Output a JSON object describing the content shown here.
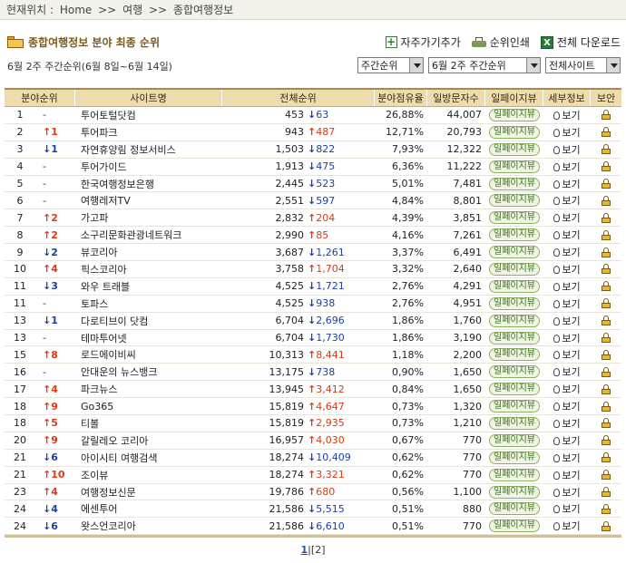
{
  "breadcrumb": {
    "label": "현재위치 :",
    "items": [
      "Home",
      ">>",
      "여행",
      ">>",
      "종합여행정보"
    ]
  },
  "page_title": "종합여행정보 분야 최종 순위",
  "toolbar": {
    "favorite": "자주가기추가",
    "print": "순위인쇄",
    "download": "전체 다운로드"
  },
  "sub_info": "6월 2주 주간순위(6월 8일~6월 14일)",
  "selects": {
    "period_type": "주간순위",
    "week": "6월 2주 주간순위",
    "scope": "전체사이트"
  },
  "columns": [
    "분야순위",
    "사이트명",
    "전체순위",
    "분야점유율",
    "일방문자수",
    "일페이지뷰",
    "세부정보",
    "보안"
  ],
  "view_label": "일페이지뷰",
  "detail_label": "보기",
  "colors": {
    "up": "#e03a12",
    "down": "#1b3fa8",
    "header": "#efdcae"
  },
  "rows": [
    {
      "rank": "1",
      "arrow": "",
      "chg": "-",
      "name": "투어토털닷컴",
      "total": "453",
      "tarrow": "↓",
      "tchg": "63",
      "share": "26,88%",
      "visitors": "44,007"
    },
    {
      "rank": "2",
      "arrow": "↑",
      "chg": "1",
      "name": "투어파크",
      "total": "943",
      "tarrow": "↑",
      "tchg": "487",
      "share": "12,71%",
      "visitors": "20,793"
    },
    {
      "rank": "3",
      "arrow": "↓",
      "chg": "1",
      "name": "자연휴양림 정보서비스",
      "total": "1,503",
      "tarrow": "↓",
      "tchg": "822",
      "share": "7,93%",
      "visitors": "12,322"
    },
    {
      "rank": "4",
      "arrow": "",
      "chg": "-",
      "name": "투어가이드",
      "total": "1,913",
      "tarrow": "↓",
      "tchg": "475",
      "share": "6,36%",
      "visitors": "11,222"
    },
    {
      "rank": "5",
      "arrow": "",
      "chg": "-",
      "name": "한국여행정보은행",
      "total": "2,445",
      "tarrow": "↓",
      "tchg": "523",
      "share": "5,01%",
      "visitors": "7,481"
    },
    {
      "rank": "6",
      "arrow": "",
      "chg": "-",
      "name": "여행레저TV",
      "total": "2,551",
      "tarrow": "↓",
      "tchg": "597",
      "share": "4,84%",
      "visitors": "8,801"
    },
    {
      "rank": "7",
      "arrow": "↑",
      "chg": "2",
      "name": "가고파",
      "total": "2,832",
      "tarrow": "↑",
      "tchg": "204",
      "share": "4,39%",
      "visitors": "3,851"
    },
    {
      "rank": "8",
      "arrow": "↑",
      "chg": "2",
      "name": "소구리문화관광네트워크",
      "total": "2,990",
      "tarrow": "↑",
      "tchg": "85",
      "share": "4,16%",
      "visitors": "7,261"
    },
    {
      "rank": "9",
      "arrow": "↓",
      "chg": "2",
      "name": "뷰코리아",
      "total": "3,687",
      "tarrow": "↓",
      "tchg": "1,261",
      "share": "3,37%",
      "visitors": "6,491"
    },
    {
      "rank": "10",
      "arrow": "↑",
      "chg": "4",
      "name": "픽스코리아",
      "total": "3,758",
      "tarrow": "↑",
      "tchg": "1,704",
      "share": "3,32%",
      "visitors": "2,640"
    },
    {
      "rank": "11",
      "arrow": "↓",
      "chg": "3",
      "name": "와우 트래블",
      "total": "4,525",
      "tarrow": "↓",
      "tchg": "1,721",
      "share": "2,76%",
      "visitors": "4,291"
    },
    {
      "rank": "11",
      "arrow": "",
      "chg": "-",
      "name": "토파스",
      "total": "4,525",
      "tarrow": "↓",
      "tchg": "938",
      "share": "2,76%",
      "visitors": "4,951"
    },
    {
      "rank": "13",
      "arrow": "↓",
      "chg": "1",
      "name": "다로티브이 닷컴",
      "total": "6,704",
      "tarrow": "↓",
      "tchg": "2,696",
      "share": "1,86%",
      "visitors": "1,760"
    },
    {
      "rank": "13",
      "arrow": "",
      "chg": "-",
      "name": "테마투어넷",
      "total": "6,704",
      "tarrow": "↓",
      "tchg": "1,730",
      "share": "1,86%",
      "visitors": "3,190"
    },
    {
      "rank": "15",
      "arrow": "↑",
      "chg": "8",
      "name": "로드에이비씨",
      "total": "10,313",
      "tarrow": "↑",
      "tchg": "8,441",
      "share": "1,18%",
      "visitors": "2,200"
    },
    {
      "rank": "16",
      "arrow": "",
      "chg": "-",
      "name": "안대운의 뉴스뱅크",
      "total": "13,175",
      "tarrow": "↓",
      "tchg": "738",
      "share": "0,90%",
      "visitors": "1,650"
    },
    {
      "rank": "17",
      "arrow": "↑",
      "chg": "4",
      "name": "파크뉴스",
      "total": "13,945",
      "tarrow": "↑",
      "tchg": "3,412",
      "share": "0,84%",
      "visitors": "1,650"
    },
    {
      "rank": "18",
      "arrow": "↑",
      "chg": "9",
      "name": "Go365",
      "total": "15,819",
      "tarrow": "↑",
      "tchg": "4,647",
      "share": "0,73%",
      "visitors": "1,320"
    },
    {
      "rank": "18",
      "arrow": "↑",
      "chg": "5",
      "name": "티볼",
      "total": "15,819",
      "tarrow": "↑",
      "tchg": "2,935",
      "share": "0,73%",
      "visitors": "1,210"
    },
    {
      "rank": "20",
      "arrow": "↑",
      "chg": "9",
      "name": "갈릴레오 코리아",
      "total": "16,957",
      "tarrow": "↑",
      "tchg": "4,030",
      "share": "0,67%",
      "visitors": "770"
    },
    {
      "rank": "21",
      "arrow": "↓",
      "chg": "6",
      "name": "아이시티 여행검색",
      "total": "18,274",
      "tarrow": "↓",
      "tchg": "10,409",
      "share": "0,62%",
      "visitors": "770"
    },
    {
      "rank": "21",
      "arrow": "↑",
      "chg": "10",
      "name": "조이뷰",
      "total": "18,274",
      "tarrow": "↑",
      "tchg": "3,321",
      "share": "0,62%",
      "visitors": "770"
    },
    {
      "rank": "23",
      "arrow": "↑",
      "chg": "4",
      "name": "여행정보신문",
      "total": "19,786",
      "tarrow": "↑",
      "tchg": "680",
      "share": "0,56%",
      "visitors": "1,100"
    },
    {
      "rank": "24",
      "arrow": "↓",
      "chg": "4",
      "name": "에센투어",
      "total": "21,586",
      "tarrow": "↓",
      "tchg": "5,515",
      "share": "0,51%",
      "visitors": "880"
    },
    {
      "rank": "24",
      "arrow": "↓",
      "chg": "6",
      "name": "왓스언코리아",
      "total": "21,586",
      "tarrow": "↓",
      "tchg": "6,610",
      "share": "0,51%",
      "visitors": "770"
    }
  ],
  "pager": {
    "current": "1",
    "next": "2"
  }
}
